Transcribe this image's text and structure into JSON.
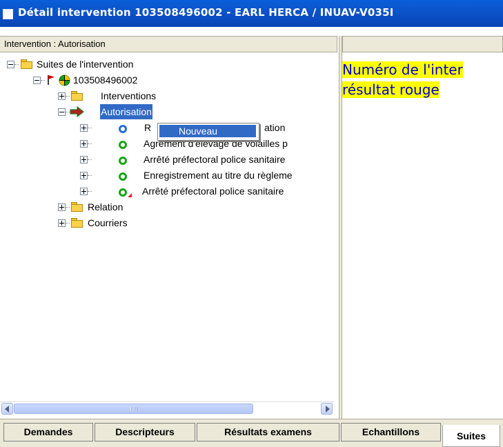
{
  "window": {
    "title": "Détail intervention 103508496002 - EARL HERCA / INUAV-V035I"
  },
  "left_panel": {
    "header": "Intervention : Autorisation"
  },
  "tree": {
    "root": "Suites de l'intervention",
    "intervention_id": "103508496002",
    "interventions": "Interventions",
    "autorisation": "Autorisation",
    "items": [
      "Réglementation",
      "Agrément d'élevage de volailles p",
      "Arrêté préfectoral police sanitaire",
      "Enregistrement au titre du règleme",
      "Arrêté préfectoral police sanitaire"
    ],
    "item1_visible": "R",
    "item1_tail": "ation",
    "relation": "Relation",
    "courriers": "Courriers"
  },
  "context_menu": {
    "items": [
      "Nouveau"
    ],
    "selected": "Nouveau"
  },
  "right_panel": {
    "note_line1": "Numéro de l'inter",
    "note_line2": "résultat rouge",
    "note_color": "#0000cc",
    "note_highlight": "#ffff00"
  },
  "tabs": [
    {
      "label": "Demandes",
      "active": false
    },
    {
      "label": "Descripteurs",
      "active": false
    },
    {
      "label": "Résultats examens",
      "active": false
    },
    {
      "label": "Echantillons",
      "active": false
    },
    {
      "label": "Suites",
      "active": true
    }
  ],
  "colors": {
    "titlebar": "#0b4ec4",
    "selection": "#316ac5",
    "status_green": "#19a319",
    "status_blue": "#2a6ad8",
    "flag_red": "#d00000"
  },
  "icons": [
    "window-icon",
    "folder-icon",
    "flag-icon",
    "target-icon",
    "arrow-icon",
    "status-ring-icon",
    "scroll-left-icon",
    "scroll-right-icon"
  ]
}
